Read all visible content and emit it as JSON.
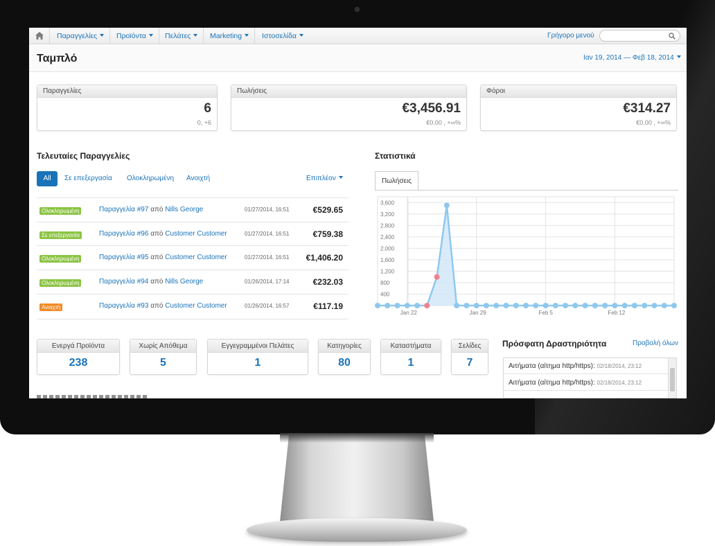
{
  "nav": {
    "items": [
      "Παραγγελίες",
      "Προϊόντα",
      "Πελάτες",
      "Marketing",
      "Ιστοσελίδα"
    ],
    "quick_menu": "Γρήγορο μενού",
    "search_placeholder": ""
  },
  "header": {
    "title": "Ταμπλό",
    "date_range": "Ιαν 19, 2014 — Φεβ 18, 2014"
  },
  "stats": [
    {
      "label": "Παραγγελίες",
      "value": "6",
      "sub": "0, +6"
    },
    {
      "label": "Πωλήσεις",
      "value": "€3,456.91",
      "sub": "€0.00 , +∞%"
    },
    {
      "label": "Φόροι",
      "value": "€314.27",
      "sub": "€0.00 , +∞%"
    }
  ],
  "recent_orders": {
    "title": "Τελευταίες Παραγγελίες",
    "filters": [
      "All",
      "Σε επεξεργασία",
      "Ολοκληρωμένη",
      "Ανοιχτή"
    ],
    "more": "Επιπλέον",
    "by_word": "από",
    "rows": [
      {
        "status": "Ολοκληρωμένη",
        "status_color": "#8bc443",
        "order": "Παραγγελία #97",
        "customer": "Nills George",
        "date": "01/27/2014, 16:51",
        "amount": "€529.65"
      },
      {
        "status": "Σε επεξεργασία",
        "status_color": "#8bc443",
        "order": "Παραγγελία #96",
        "customer": "Customer Customer",
        "date": "01/27/2014, 16:51",
        "amount": "€759.38"
      },
      {
        "status": "Ολοκληρωμένη",
        "status_color": "#8bc443",
        "order": "Παραγγελία #95",
        "customer": "Customer Customer",
        "date": "01/27/2014, 16:51",
        "amount": "€1,406.20"
      },
      {
        "status": "Ολοκληρωμένη",
        "status_color": "#8bc443",
        "order": "Παραγγελία #94",
        "customer": "Nills George",
        "date": "01/26/2014, 17:14",
        "amount": "€232.03"
      },
      {
        "status": "Ανοιχτή",
        "status_color": "#f08b25",
        "order": "Παραγγελία #93",
        "customer": "Customer Customer",
        "date": "01/26/2014, 16:57",
        "amount": "€117.19"
      }
    ]
  },
  "statistics": {
    "title": "Στατιστικά",
    "tab": "Πωλήσεις"
  },
  "chart_data": {
    "type": "area",
    "series": [
      {
        "color": "#8fc8ee",
        "values": [
          0,
          0,
          0,
          0,
          0,
          0,
          1000,
          3500,
          0,
          0,
          0,
          0,
          0,
          0,
          0,
          0,
          0,
          0,
          0,
          0,
          0,
          0,
          0,
          0,
          0,
          0,
          0,
          0,
          0,
          0,
          0
        ]
      }
    ],
    "highlight_indices": [
      5,
      6
    ],
    "highlight_color": "#f08090",
    "x_tick_labels": [
      {
        "label": "Jan 22",
        "index": 3
      },
      {
        "label": "Jan 29",
        "index": 10
      },
      {
        "label": "Feb 5",
        "index": 17
      },
      {
        "label": "Feb 12",
        "index": 24
      }
    ],
    "y_ticks": [
      400,
      800,
      1200,
      1600,
      2000,
      2400,
      2800,
      3200,
      3600
    ],
    "y_tick_labels": [
      "400",
      "800",
      "1,200",
      "1,600",
      "2,000",
      "2,400",
      "2,800",
      "3,200",
      "3,600"
    ],
    "ylim": [
      0,
      3800
    ],
    "grid": true
  },
  "counts": [
    {
      "label": "Ενεργά Προϊόντα",
      "value": "238"
    },
    {
      "label": "Χωρίς Απόθεμα",
      "value": "5"
    },
    {
      "label": "Εγγεγραμμένοι Πελάτες",
      "value": "1"
    },
    {
      "label": "Κατηγορίες",
      "value": "80"
    },
    {
      "label": "Καταστήματα",
      "value": "1"
    },
    {
      "label": "Σελίδες",
      "value": "7"
    }
  ],
  "activity": {
    "title": "Πρόσφατη Δραστηριότητα",
    "view_all": "Προβολή όλων",
    "items": [
      {
        "text": "Αιτήματα (αίτημα http/https):",
        "time": "02/18/2014, 23:12"
      },
      {
        "text": "Αιτήματα (αίτημα http/https):",
        "time": "02/18/2014, 23:12"
      }
    ]
  }
}
